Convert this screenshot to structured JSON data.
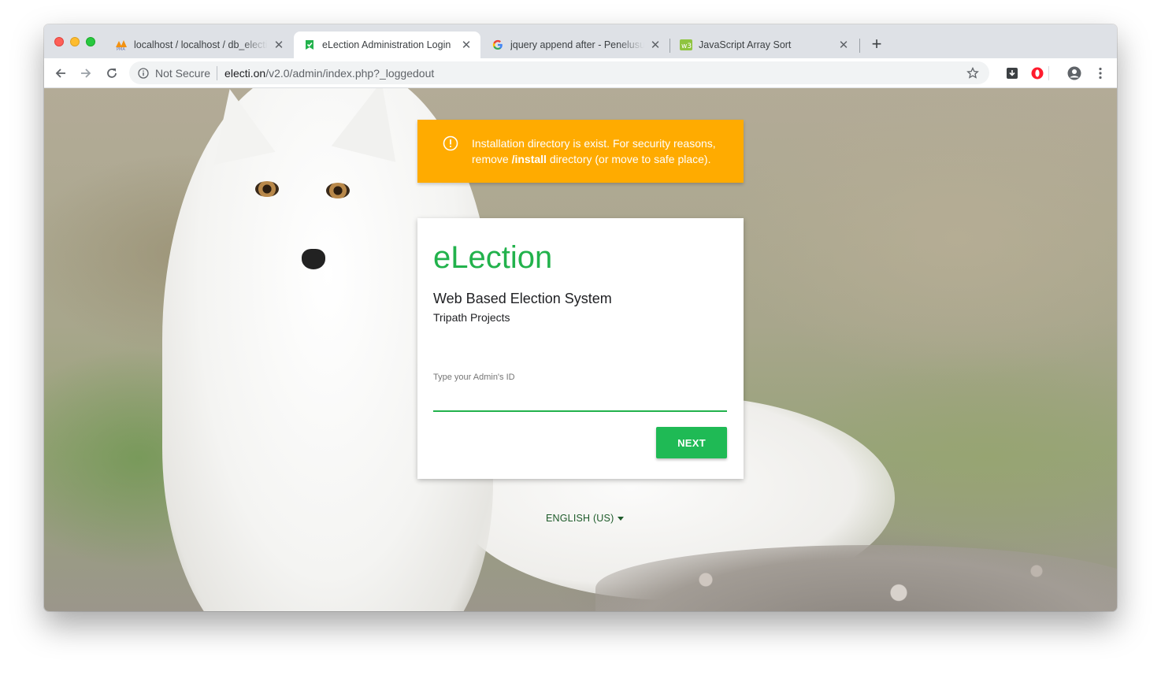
{
  "browser": {
    "tabs": [
      {
        "title": "localhost / localhost / db_election",
        "favicon": "phpmyadmin-icon"
      },
      {
        "title": "eLection Administration Login",
        "favicon": "election-icon"
      },
      {
        "title": "jquery append after - Penelusuran Google",
        "favicon": "google-icon"
      },
      {
        "title": "JavaScript Array Sort",
        "favicon": "w3schools-icon"
      }
    ],
    "address": {
      "security": "Not Secure",
      "host": "electi.on",
      "path": "/v2.0/admin/index.php?_loggedout"
    }
  },
  "alert": {
    "line1": "Installation directory is exist. For security reasons,",
    "pre": "remove ",
    "bold": "/install",
    "post": " directory (or move to safe place)."
  },
  "login": {
    "app_name": "eLection",
    "subtitle": "Web Based Election System",
    "byline": "Tripath Projects",
    "field_label": "Type your Admin's ID",
    "field_value": "",
    "next_label": "NEXT"
  },
  "language": {
    "selected": "ENGLISH (US)"
  },
  "colors": {
    "accent": "#22b24c",
    "button": "#1fba55",
    "alert": "#ffab00"
  }
}
